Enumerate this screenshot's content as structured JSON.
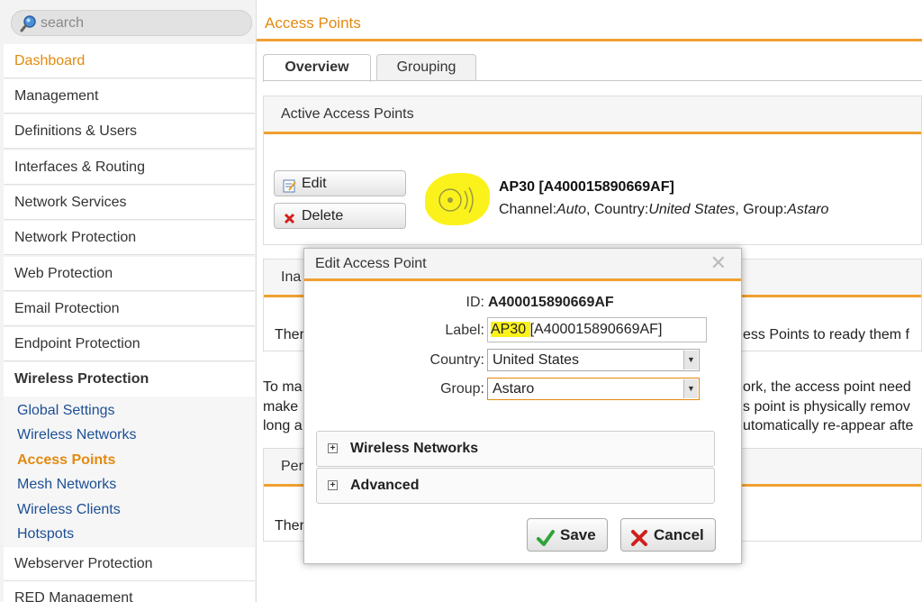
{
  "search": {
    "placeholder": "search"
  },
  "sidebar": {
    "items": [
      {
        "label": "Dashboard"
      },
      {
        "label": "Management"
      },
      {
        "label": "Definitions & Users"
      },
      {
        "label": "Interfaces & Routing"
      },
      {
        "label": "Network Services"
      },
      {
        "label": "Network Protection"
      },
      {
        "label": "Web Protection"
      },
      {
        "label": "Email Protection"
      },
      {
        "label": "Endpoint Protection"
      },
      {
        "label": "Wireless Protection"
      }
    ],
    "subitems": [
      {
        "label": "Global Settings"
      },
      {
        "label": "Wireless Networks"
      },
      {
        "label": "Access Points"
      },
      {
        "label": "Mesh Networks"
      },
      {
        "label": "Wireless Clients"
      },
      {
        "label": "Hotspots"
      }
    ],
    "after": [
      {
        "label": "Webserver Protection"
      },
      {
        "label": "RED Management"
      }
    ],
    "accent_color": "#e28a10",
    "link_color": "#1c4f94"
  },
  "main": {
    "title": "Access Points",
    "tabs": [
      {
        "label": "Overview"
      },
      {
        "label": "Grouping"
      }
    ],
    "active_panel": {
      "title": "Active Access Points"
    },
    "edit_button": "Edit",
    "delete_button": "Delete",
    "ap": {
      "name": "AP30 [A400015890669AF]",
      "channel_label": "Channel:",
      "channel_value": "Auto",
      "country_label": ", Country:",
      "country_value": "United States",
      "group_label": ", Group:",
      "group_value": "Astaro"
    },
    "inactive_panel": {
      "title": "Ina"
    },
    "inactive_text_left": "Ther",
    "inactive_text_right": "ess Points to ready them f",
    "para_left": [
      "To ma",
      "make",
      "long a"
    ],
    "para_right": [
      "ork, the access point need",
      "s point is physically remov",
      "utomatically re-appear afte"
    ],
    "pending_panel": {
      "title": "Per"
    },
    "pending_text_left": "Ther"
  },
  "modal": {
    "title": "Edit Access Point",
    "id_label": "ID:",
    "id_value": "A400015890669AF",
    "label_label": "Label:",
    "label_highlight": "AP30 ",
    "label_rest": "[A400015890669AF]",
    "country_label": "Country:",
    "country_value": "United States",
    "group_label": "Group:",
    "group_value": "Astaro",
    "sections": [
      {
        "label": "Wireless Networks"
      },
      {
        "label": "Advanced"
      }
    ],
    "save_label": "Save",
    "cancel_label": "Cancel"
  },
  "colors": {
    "highlight": "#fbf21c",
    "rule": "#f0a030"
  },
  "icons": [
    "search-icon",
    "edit-icon",
    "delete-icon",
    "access-point-icon",
    "close-icon",
    "expand-icon",
    "checkmark-icon",
    "cross-icon",
    "dropdown-arrow-icon"
  ]
}
